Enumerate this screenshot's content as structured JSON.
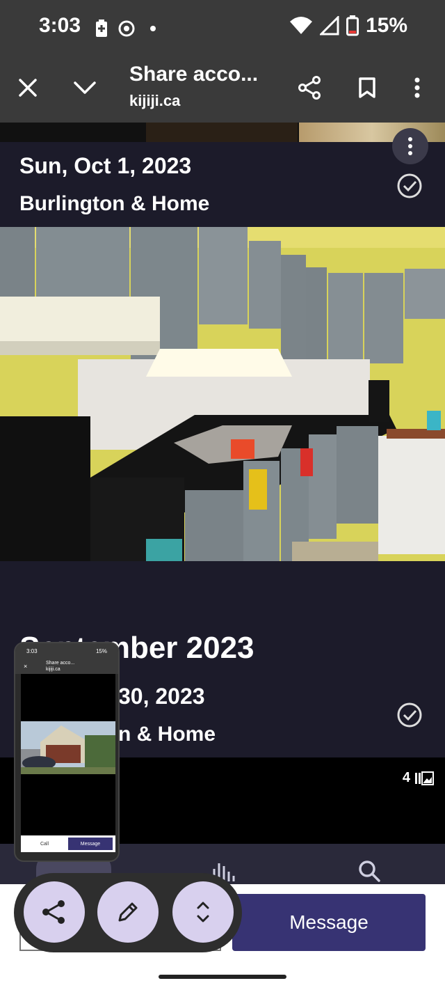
{
  "status_bar": {
    "time": "3:03",
    "battery": "15%",
    "icons": [
      "battery-saver-icon",
      "chrome-icon",
      "dot-icon",
      "wifi-icon",
      "signal-icon",
      "battery-icon"
    ]
  },
  "toolbar": {
    "title": "Share acco...",
    "url": "kijiji.ca",
    "icons": [
      "close-icon",
      "chevron-down-icon",
      "share-icon",
      "bookmark-icon",
      "more-vert-icon"
    ]
  },
  "listing_1": {
    "date": "Sun, Oct 1, 2023",
    "location": "Burlington & Home"
  },
  "month_header": "September 2023",
  "listing_2": {
    "date_visible": "30, 2023",
    "location_visible": "n & Home"
  },
  "photo_count": "4",
  "thumbnail": {
    "time": "3:03",
    "battery": "15%",
    "title": "Share acco...",
    "url": "kijiji.ca",
    "call_label": "Call",
    "message_label": "Message"
  },
  "bottom": {
    "message_label": "Message"
  },
  "colors": {
    "background": "#1c1b2a",
    "toolbar": "#3a3a3a",
    "message_button": "#373373",
    "fab": "#d8d0ee"
  }
}
